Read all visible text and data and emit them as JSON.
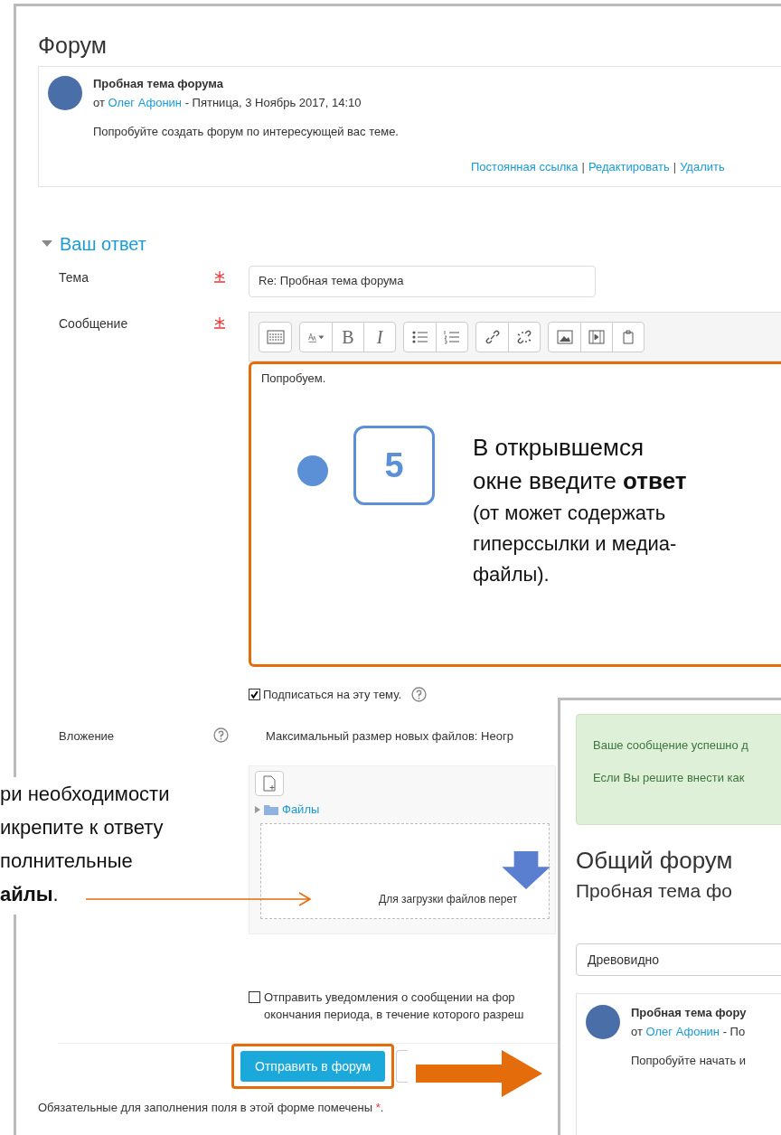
{
  "page_title": "Форум",
  "post": {
    "subject": "Пробная тема форума",
    "by": "от",
    "author": "Олег Афонин",
    "date": "- Пятница, 3 Ноябрь 2017, 14:10",
    "message": "Попробуйте создать форум по интересующей вас теме.",
    "links": [
      "Постоянная ссылка",
      "Редактировать",
      "Удалить"
    ],
    "link_separator": "|"
  },
  "section": {
    "title": "Ваш ответ",
    "expanded": true
  },
  "subject_field": {
    "label": "Тема",
    "required": true,
    "value": "Re: Пробная тема форума"
  },
  "message_field": {
    "label": "Сообщение",
    "required": true,
    "value": "Попробуем.",
    "bold": "B",
    "italic": "I"
  },
  "subscribe": {
    "label": "Подписаться на эту тему.",
    "checked": true
  },
  "attachment": {
    "label": "Вложение",
    "max_size": "Максимальный размер новых файлов: Неогр",
    "folder": "Файлы",
    "drop_hint": "Для загрузки файлов перет"
  },
  "notify": {
    "lines": [
      "Отправить уведомления о сообщении на фор",
      "окончания периода, в течение которого разреш"
    ],
    "checked": false
  },
  "submit": "Отправить в форум",
  "footer_note": "Обязательные для заполнения поля в этой форме помечены",
  "required_mark": "*",
  "footer_end": ".",
  "step_callout": {
    "number": "5",
    "text": "В открывшемся окне введите **ответ**",
    "note": "(от может содержать гиперссылки и медиа-файлы)."
  },
  "files_callout": {
    "lines": [
      "ри необходимости",
      "икрепите к ответу",
      "полнительные",
      "**айлы**."
    ]
  },
  "result_window": {
    "alert_lines": [
      "Ваше сообщение успешно д",
      "Если Вы решите внести как"
    ],
    "title": "Общий форум",
    "subtitle": "Пробная тема фо",
    "display_mode": "Древовидно",
    "post": {
      "subject": "Пробная тема фору",
      "by": "от",
      "author": "Олег Афонин",
      "date": "- По",
      "message": "Попробуйте начать и"
    }
  }
}
